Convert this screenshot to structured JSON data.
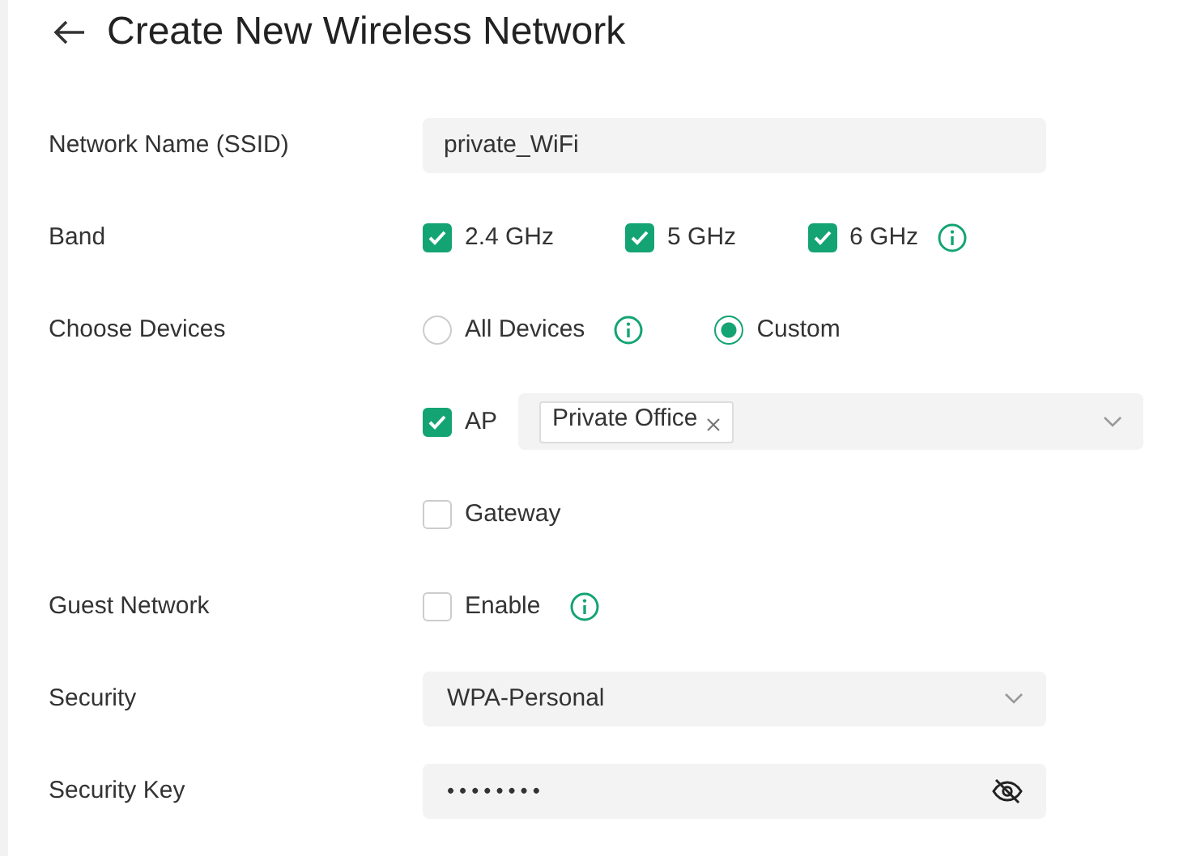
{
  "title": "Create New Wireless Network",
  "network_name": {
    "label": "Network Name (SSID)",
    "value": "private_WiFi"
  },
  "band": {
    "label": "Band",
    "options": [
      {
        "label": "2.4 GHz",
        "checked": true
      },
      {
        "label": "5 GHz",
        "checked": true
      },
      {
        "label": "6 GHz",
        "checked": true
      }
    ]
  },
  "choose_devices": {
    "label": "Choose Devices",
    "options": [
      {
        "label": "All Devices",
        "selected": false
      },
      {
        "label": "Custom",
        "selected": true
      }
    ],
    "devices": [
      {
        "label": "AP",
        "checked": true,
        "tags": [
          "Private Office"
        ]
      },
      {
        "label": "Gateway",
        "checked": false
      }
    ]
  },
  "guest_network": {
    "label": "Guest Network",
    "enable": {
      "label": "Enable",
      "checked": false
    }
  },
  "security": {
    "label": "Security",
    "value": "WPA-Personal"
  },
  "security_key": {
    "label": "Security Key",
    "value": "••••••••"
  }
}
